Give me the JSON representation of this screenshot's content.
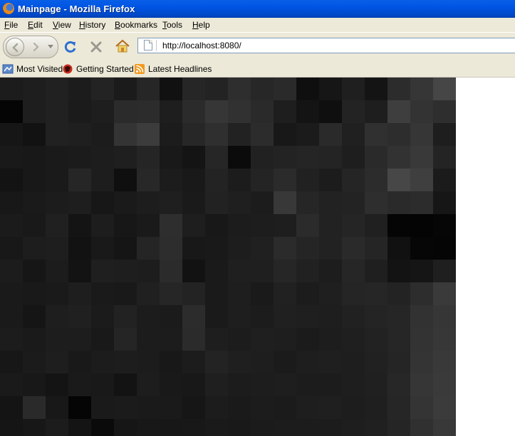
{
  "window": {
    "title": "Mainpage - Mozilla Firefox"
  },
  "menu": {
    "items": [
      "File",
      "Edit",
      "View",
      "History",
      "Bookmarks",
      "Tools",
      "Help"
    ]
  },
  "nav": {
    "url": "http://localhost:8080/",
    "icons": [
      "back-icon",
      "forward-icon",
      "reload-icon",
      "stop-icon",
      "home-icon",
      "page-icon"
    ]
  },
  "bookmarks": {
    "items": [
      "Most Visited",
      "Getting Started",
      "Latest Headlines"
    ]
  },
  "content": {
    "mosaic_colors": [
      [
        "#1c1c1c",
        "#1e1e1e",
        "#212121",
        "#1c1c1c",
        "#232323",
        "#1b1b1b",
        "#262626",
        "#111111",
        "#262626",
        "#232323",
        "#2e2e2e",
        "#272727",
        "#2a2a2a",
        "#0f0f0f",
        "#161616",
        "#1f1f1f",
        "#141414",
        "#2c2c2c",
        "#363636",
        "#464646"
      ],
      [
        "#050505",
        "#1e1e1e",
        "#212121",
        "#1b1b1b",
        "#1e1e1e",
        "#2b2b2b",
        "#2c2c2c",
        "#1e1e1e",
        "#2b2b2b",
        "#363636",
        "#313131",
        "#2a2a2a",
        "#1e1e1e",
        "#141414",
        "#0f0f0f",
        "#232323",
        "#1e1e1e",
        "#3e3e3e",
        "#333333",
        "#2e2e2e"
      ],
      [
        "#161616",
        "#121212",
        "#212121",
        "#1f1f1f",
        "#1c1c1c",
        "#343434",
        "#3c3c3c",
        "#1c1c1c",
        "#272727",
        "#2f2f2f",
        "#222222",
        "#2c2c2c",
        "#181818",
        "#1b1b1b",
        "#2a2a2a",
        "#202020",
        "#303030",
        "#2d2d2d",
        "#363636",
        "#1e1e1e"
      ],
      [
        "#191919",
        "#181818",
        "#1a1a1a",
        "#1b1b1b",
        "#1d1d1d",
        "#1f1f1f",
        "#252525",
        "#191919",
        "#141414",
        "#262626",
        "#0b0b0b",
        "#212121",
        "#232323",
        "#252525",
        "#242424",
        "#1e1e1e",
        "#2a2a2a",
        "#323232",
        "#393939",
        "#242424"
      ],
      [
        "#131313",
        "#181818",
        "#1a1a1a",
        "#262626",
        "#1d1d1d",
        "#0f0f0f",
        "#282828",
        "#1c1c1c",
        "#191919",
        "#232323",
        "#1c1c1c",
        "#242424",
        "#2b2b2b",
        "#212121",
        "#1c1c1c",
        "#252525",
        "#2c2c2c",
        "#474747",
        "#3f3f3f",
        "#1b1b1b"
      ],
      [
        "#181818",
        "#1a1a1a",
        "#1c1c1c",
        "#1e1e1e",
        "#171717",
        "#1a1a1a",
        "#1d1d1d",
        "#1f1f1f",
        "#1a1a1a",
        "#222222",
        "#1f1f1f",
        "#1c1c1c",
        "#383838",
        "#262626",
        "#222222",
        "#232323",
        "#2e2e2e",
        "#2a2a2a",
        "#2c2c2c",
        "#161616"
      ],
      [
        "#1b1b1b",
        "#191919",
        "#202020",
        "#141414",
        "#1d1d1d",
        "#171717",
        "#1a1a1a",
        "#2e2e2e",
        "#1e1e1e",
        "#181818",
        "#1c1c1c",
        "#1d1d1d",
        "#1e1e1e",
        "#2b2b2b",
        "#222222",
        "#252525",
        "#202020",
        "#050505",
        "#040404",
        "#060606"
      ],
      [
        "#181818",
        "#1d1d1d",
        "#1e1e1e",
        "#121212",
        "#191919",
        "#151515",
        "#252525",
        "#2d2d2d",
        "#181818",
        "#191919",
        "#1d1d1d",
        "#202020",
        "#2b2b2b",
        "#252525",
        "#222222",
        "#2a2a2a",
        "#252525",
        "#111111",
        "#060606",
        "#050505"
      ],
      [
        "#1c1c1c",
        "#161616",
        "#1c1c1c",
        "#131313",
        "#1f1f1f",
        "#1e1e1e",
        "#1d1d1d",
        "#2b2b2b",
        "#121212",
        "#1a1a1a",
        "#1f1f1f",
        "#1f1f1f",
        "#262626",
        "#212121",
        "#1d1d1d",
        "#262626",
        "#1f1f1f",
        "#131313",
        "#151515",
        "#1f1f1f"
      ],
      [
        "#1a1a1a",
        "#191919",
        "#1a1a1a",
        "#1e1e1e",
        "#1a1a1a",
        "#191919",
        "#202020",
        "#262626",
        "#232323",
        "#1a1a1a",
        "#1e1e1e",
        "#1a1a1a",
        "#212121",
        "#1c1c1c",
        "#1f1f1f",
        "#252525",
        "#262626",
        "#232323",
        "#2d2d2d",
        "#3a3a3a"
      ],
      [
        "#1a1a1a",
        "#151515",
        "#1e1e1e",
        "#202020",
        "#1b1b1b",
        "#222222",
        "#1c1c1c",
        "#1b1b1b",
        "#2c2c2c",
        "#1a1a1a",
        "#1e1e1e",
        "#1c1c1c",
        "#202020",
        "#1f1f1f",
        "#1e1e1e",
        "#212121",
        "#242424",
        "#262626",
        "#323232",
        "#363636"
      ],
      [
        "#1c1c1c",
        "#1a1a1a",
        "#1d1d1d",
        "#1d1d1d",
        "#191919",
        "#252525",
        "#1c1c1c",
        "#1c1c1c",
        "#2b2b2b",
        "#1e1e1e",
        "#1c1c1c",
        "#1f1f1f",
        "#1e1e1e",
        "#1b1b1b",
        "#1d1d1d",
        "#1f1f1f",
        "#222222",
        "#262626",
        "#333333",
        "#373737"
      ],
      [
        "#171717",
        "#1b1b1b",
        "#1e1e1e",
        "#191919",
        "#1c1c1c",
        "#1d1d1d",
        "#1c1c1c",
        "#181818",
        "#1c1c1c",
        "#232323",
        "#1f1f1f",
        "#1e1e1e",
        "#1b1b1b",
        "#1e1e1e",
        "#1f1f1f",
        "#1e1e1e",
        "#212121",
        "#252525",
        "#343434",
        "#393939"
      ],
      [
        "#1a1a1a",
        "#181818",
        "#141414",
        "#1a1a1a",
        "#191919",
        "#131313",
        "#1d1d1d",
        "#191919",
        "#181818",
        "#1f1f1f",
        "#1c1c1c",
        "#1d1d1d",
        "#1e1e1e",
        "#1c1c1c",
        "#1c1c1c",
        "#1e1e1e",
        "#202020",
        "#272727",
        "#363636",
        "#3a3a3a"
      ],
      [
        "#141414",
        "#2a2a2a",
        "#181818",
        "#050505",
        "#1a1a1a",
        "#1b1b1b",
        "#1a1a1a",
        "#1a1a1a",
        "#161616",
        "#1c1c1c",
        "#1a1a1a",
        "#1c1c1c",
        "#1b1b1b",
        "#1e1e1e",
        "#1f1f1f",
        "#1d1d1d",
        "#1f1f1f",
        "#262626",
        "#343434",
        "#3b3b3b"
      ],
      [
        "#151515",
        "#171717",
        "#1c1c1c",
        "#141414",
        "#0a0a0a",
        "#161616",
        "#181818",
        "#171717",
        "#181818",
        "#1a1a1a",
        "#191919",
        "#1b1b1b",
        "#1c1c1c",
        "#1c1c1c",
        "#1c1c1c",
        "#1e1e1e",
        "#202020",
        "#252525",
        "#303030",
        "#383838"
      ]
    ]
  }
}
